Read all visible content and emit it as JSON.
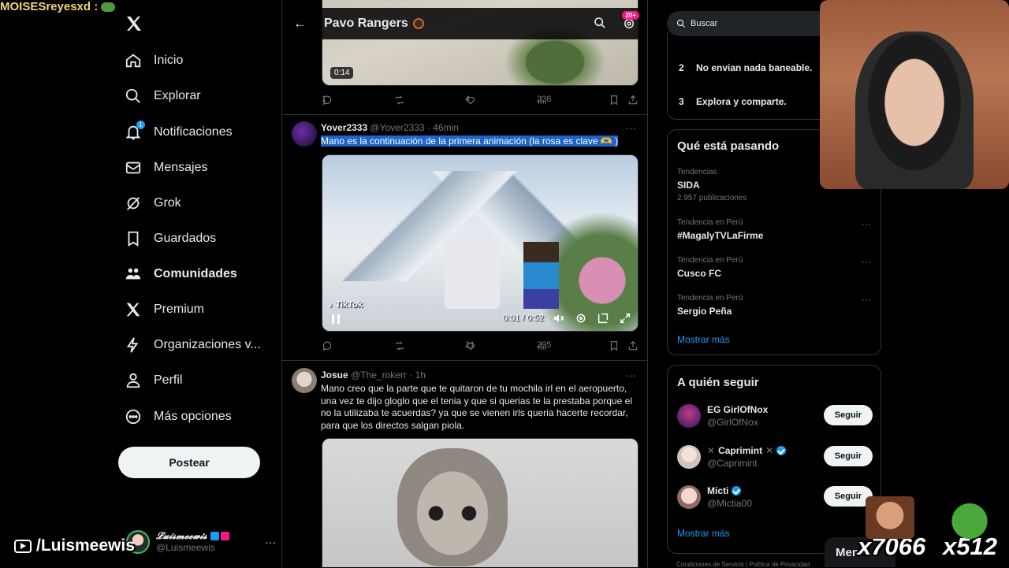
{
  "stream": {
    "chat_user": "MOISESreyesxd :",
    "channel_overlay": "/Luismeewis",
    "counters": [
      "x7066",
      "x512"
    ]
  },
  "sidebar": {
    "items": [
      {
        "label": "Inicio",
        "icon": "home-icon"
      },
      {
        "label": "Explorar",
        "icon": "search-icon"
      },
      {
        "label": "Notificaciones",
        "icon": "bell-icon",
        "badge": "1"
      },
      {
        "label": "Mensajes",
        "icon": "mail-icon"
      },
      {
        "label": "Grok",
        "icon": "grok-icon"
      },
      {
        "label": "Guardados",
        "icon": "bookmark-icon"
      },
      {
        "label": "Comunidades",
        "icon": "communities-icon"
      },
      {
        "label": "Premium",
        "icon": "x-logo-icon"
      },
      {
        "label": "Organizaciones v...",
        "icon": "lightning-icon"
      },
      {
        "label": "Perfil",
        "icon": "person-icon"
      },
      {
        "label": "Más opciones",
        "icon": "more-circle-icon"
      }
    ],
    "post_label": "Postear",
    "account": {
      "name": "𝓛𝓾𝓲𝓼𝓶𝓮𝓮𝔀𝓲𝓼",
      "handle": "@Luismeewis"
    }
  },
  "main": {
    "header_title": "Pavo Rangers",
    "notif_badge": "20+",
    "tweet0": {
      "duration": "0:14",
      "replies": "1",
      "likes": "4",
      "views": "238"
    },
    "tweet1": {
      "name": "Yover2333",
      "handle": "@Yover2333",
      "time": "· 46min",
      "text": "Mano es la continuación de la primera animación (la rosa es clave 🫶 )",
      "video_brand": "TikTok",
      "video_time": "0:01 / 0:52",
      "replies": "",
      "likes": "21",
      "views": "295"
    },
    "tweet2": {
      "name": "Josue",
      "handle": "@The_rokerr",
      "time": "· 1h",
      "text": "Mano creo que la parte que te quitaron de tu mochila irl en el aeropuerto, una vez te dijo gloglo que el tenia y que si querias te la prestaba porque el no la utilizaba te acuerdas? ya que se vienen irls queria hacerte recordar, para que los directos salgan piola."
    }
  },
  "right": {
    "search_placeholder": "Buscar",
    "steps": [
      {
        "num": "2",
        "label": "No envian nada baneable."
      },
      {
        "num": "3",
        "label": "Explora y comparte."
      }
    ],
    "trends_title": "Qué está pasando",
    "trends": [
      {
        "context": "Tendencias",
        "title": "SIDA",
        "count": "2.957 publicaciones"
      },
      {
        "context": "Tendencia en Perú",
        "title": "#MagalyTVLaFirme",
        "count": ""
      },
      {
        "context": "Tendencia en Perú",
        "title": "Cusco FC",
        "count": ""
      },
      {
        "context": "Tendencia en Perú",
        "title": "Sergio Peña",
        "count": ""
      }
    ],
    "show_more": "Mostrar más",
    "follow_title": "A quién seguir",
    "follows": [
      {
        "name": "EG GirlOfNox",
        "handle": "@GirlOfNox",
        "verified": false
      },
      {
        "name": "Caprimint",
        "handle": "@Caprimint",
        "verified": true
      },
      {
        "name": "Micti",
        "handle": "@Mictia00",
        "verified": true
      }
    ],
    "follow_button": "Seguir",
    "show_more_follow": "Mostrar más",
    "footer": "Condiciones de Servicio  |  Política de Privacidad",
    "messages_label": "Men"
  },
  "colors": {
    "accent": "#1d9bf0",
    "highlight": "#1e64c8",
    "badge": "#f91880"
  }
}
